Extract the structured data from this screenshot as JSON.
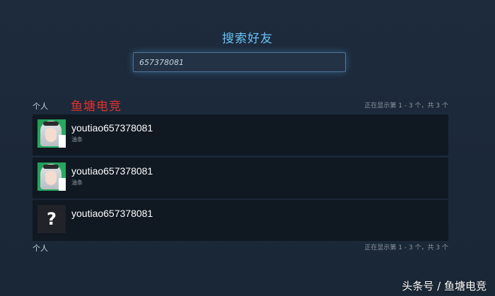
{
  "page": {
    "title": "搜索好友"
  },
  "search": {
    "value": "657378081"
  },
  "section": {
    "label": "个人",
    "results_count": "正在显示第 1 - 3 个，共 3 个"
  },
  "overlay": {
    "brand_text": "鱼塘电竞"
  },
  "results": [
    {
      "name": "youtiao657378081",
      "subtitle": "油条",
      "avatar": "anime-avatar"
    },
    {
      "name": "youtiao657378081",
      "subtitle": "油条",
      "avatar": "anime-avatar"
    },
    {
      "name": "youtiao657378081",
      "subtitle": "",
      "avatar": "question-mark"
    }
  ],
  "unknown_avatar_glyph": "?",
  "footer": {
    "label": "个人",
    "results_count": "正在显示第 1 - 3 个，共 3 个"
  },
  "watermark": {
    "text": "头条号 / 鱼塘电竞"
  },
  "colors": {
    "background": "#1b2838",
    "accent": "#67c1f5",
    "row_background": "#101822",
    "watermark_red": "#e0312e"
  }
}
